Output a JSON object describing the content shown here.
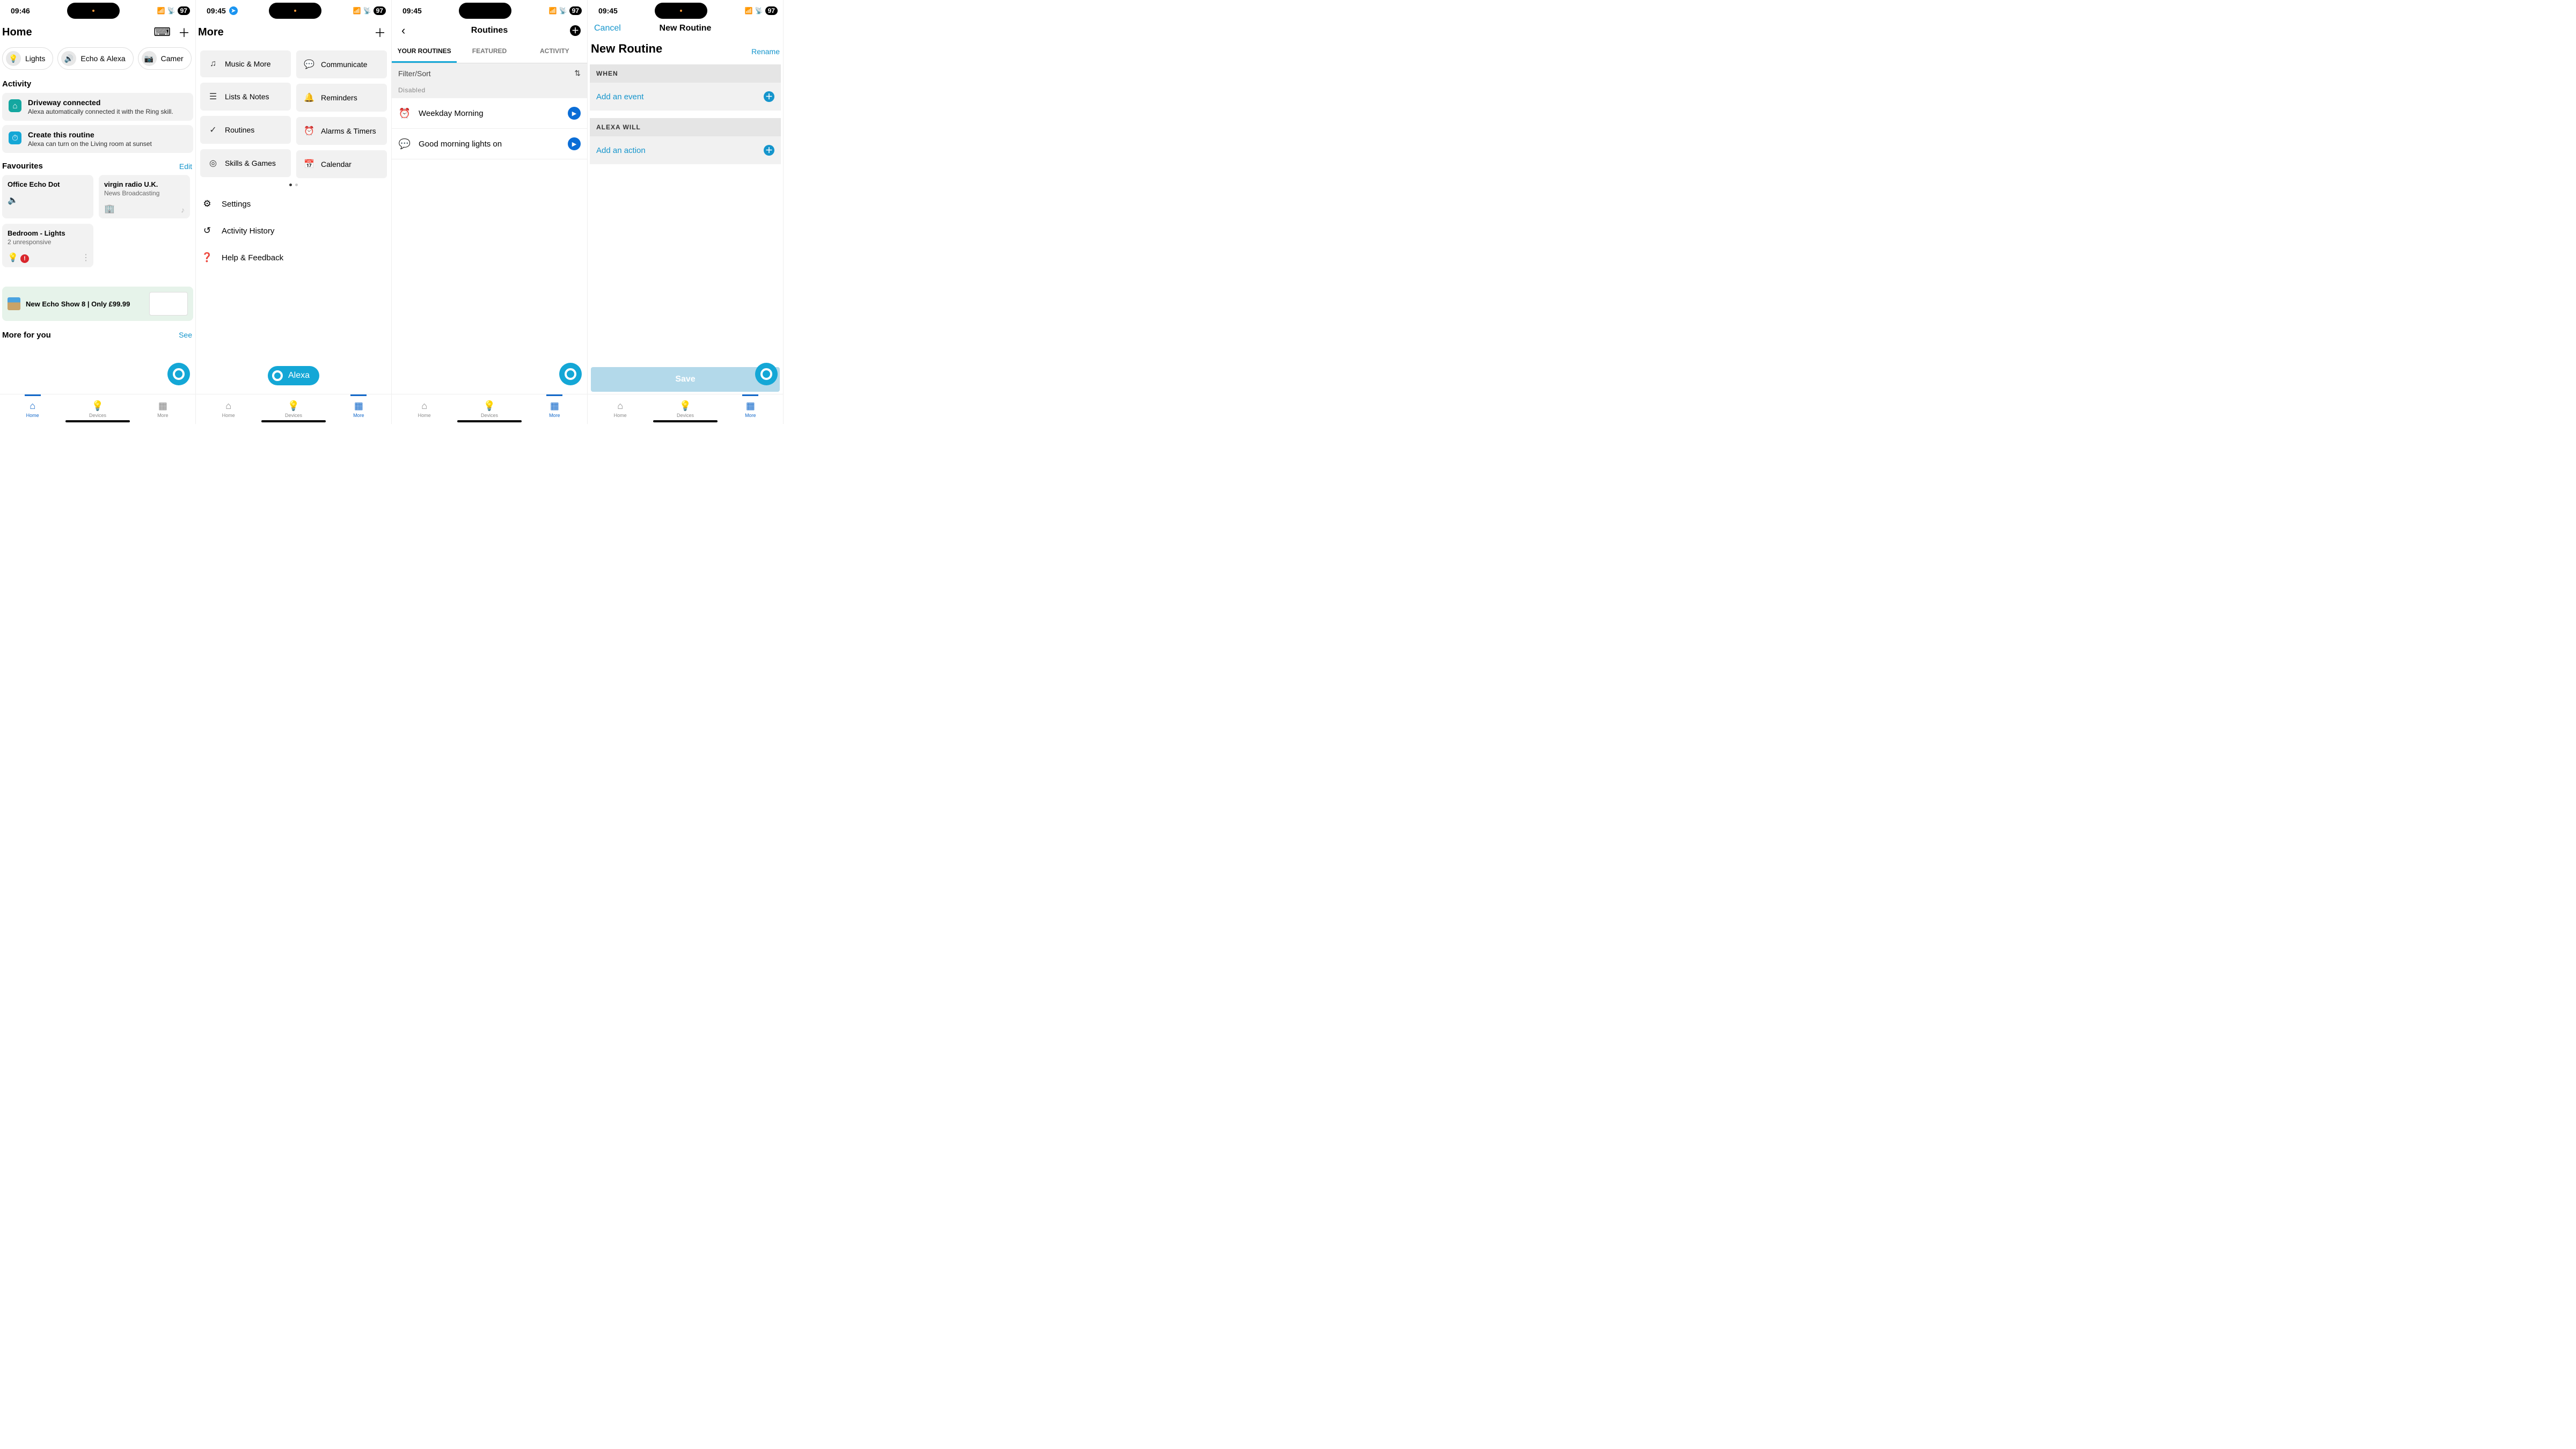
{
  "status": {
    "time1": "09:46",
    "time2": "09:45",
    "time3": "09:45",
    "time4": "09:45",
    "battery": "97"
  },
  "s1": {
    "title": "Home",
    "chips": [
      {
        "label": "Lights",
        "icon": "lightbulb"
      },
      {
        "label": "Echo & Alexa",
        "icon": "echo"
      },
      {
        "label": "Camer",
        "icon": "camera"
      }
    ],
    "activity_title": "Activity",
    "activity": [
      {
        "title": "Driveway connected",
        "sub": "Alexa automatically connected it with the Ring skill.",
        "color": "#14a7a0",
        "glyph": "wifi"
      },
      {
        "title": "Create this routine",
        "sub": "Alexa can turn on the Living room at sunset",
        "color": "#14a7d6",
        "glyph": "alarm"
      }
    ],
    "fav_title": "Favourites",
    "edit": "Edit",
    "favs": [
      {
        "title": "Office Echo Dot",
        "sub": ""
      },
      {
        "title": "virgin radio U.K.",
        "sub": "News Broadcasting"
      },
      {
        "title": "Bedroom - Lights",
        "sub": "2 unresponsive"
      }
    ],
    "promo": "New Echo Show 8 | Only £99.99",
    "more": "More for you",
    "see": "See",
    "nav": {
      "home": "Home",
      "devices": "Devices",
      "more": "More"
    }
  },
  "s2": {
    "title": "More",
    "left_tiles": [
      "Music & More",
      "Lists & Notes",
      "Routines",
      "Skills & Games"
    ],
    "right_tiles": [
      "Communicate",
      "Reminders",
      "Alarms & Timers",
      "Calendar"
    ],
    "rows": [
      "Settings",
      "Activity History",
      "Help & Feedback"
    ],
    "alexa": "Alexa"
  },
  "s3": {
    "title": "Routines",
    "tabs": [
      "YOUR ROUTINES",
      "FEATURED",
      "ACTIVITY"
    ],
    "filter": "Filter/Sort",
    "disabled": "Disabled",
    "routines": [
      {
        "label": "Weekday Morning",
        "icon": "alarm"
      },
      {
        "label": "Good morning lights on",
        "icon": "speech"
      }
    ]
  },
  "s4": {
    "cancel": "Cancel",
    "title": "New Routine",
    "heading": "New Routine",
    "rename": "Rename",
    "when": "WHEN",
    "add_event": "Add an event",
    "alexa_will": "ALEXA WILL",
    "add_action": "Add an action",
    "save": "Save"
  }
}
